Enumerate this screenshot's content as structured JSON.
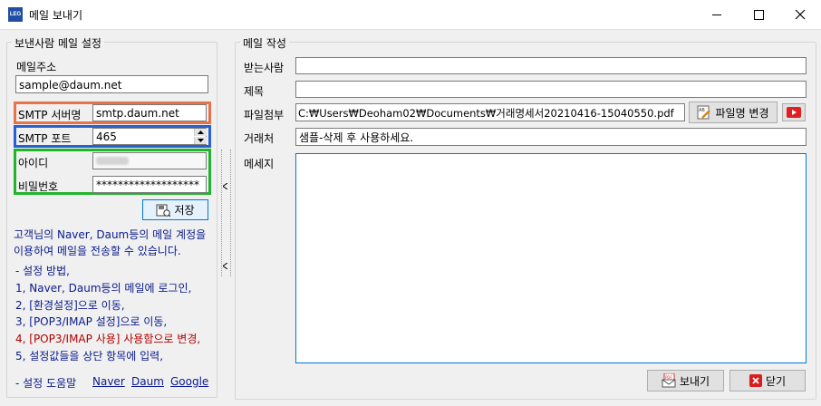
{
  "window": {
    "title": "메일 보내기",
    "app_icon_text": "LEG"
  },
  "sender": {
    "group_title": "보낸사람 메일 설정",
    "email_label": "메일주소",
    "email_value": "sample@daum.net",
    "smtp_server_label": "SMTP 서버명",
    "smtp_server_value": "smtp.daum.net",
    "smtp_port_label": "SMTP 포트",
    "smtp_port_value": "465",
    "id_label": "아이디",
    "password_label": "비밀번호",
    "password_value": "*******************",
    "save_label": "저장",
    "info_line1": "고객님의 Naver, Daum등의 메일 계정을",
    "info_line2": "이용하여 메일을 전송할 수 있습니다.",
    "steps_title": "- 설정 방법,",
    "step1": "1, Naver, Daum등의 메일에 로그인,",
    "step2": "2, [환경설정]으로 이동,",
    "step3": "3, [POP3/IMAP 설정]으로 이동,",
    "step4": "4, [POP3/IMAP 사용] 사용함으로 변경,",
    "step5": "5, 설정값들을 상단 항목에 입력,",
    "help_label": "- 설정 도움말",
    "help_links": {
      "naver": "Naver",
      "daum": "Daum",
      "google": "Google"
    }
  },
  "compose": {
    "group_title": "메일 작성",
    "to_label": "받는사람",
    "to_value": "",
    "subject_label": "제목",
    "subject_value": "",
    "attach_label": "파일첨부",
    "attach_value": "C:₩Users₩Deoham02₩Documents₩거래명세서20210416-15040550.pdf",
    "rename_label": "파일명 변경",
    "client_label": "거래처",
    "client_value": "샘플-삭제 후 사용하세요.",
    "message_label": "메세지",
    "message_value": ""
  },
  "footer": {
    "send_label": "보내기",
    "close_label": "닫기"
  },
  "colors": {
    "smtp_server_highlight": "#e8724a",
    "smtp_port_highlight": "#2a5fd4",
    "credentials_highlight": "#1fb52c"
  },
  "icons": [
    "app-logo-icon",
    "minimize-icon",
    "maximize-icon",
    "close-icon",
    "save-disk-icon",
    "rename-file-icon",
    "play-icon",
    "pdf-mail-icon",
    "close-x-icon",
    "spin-up-icon",
    "spin-down-icon",
    "collapse-arrow-icon"
  ]
}
